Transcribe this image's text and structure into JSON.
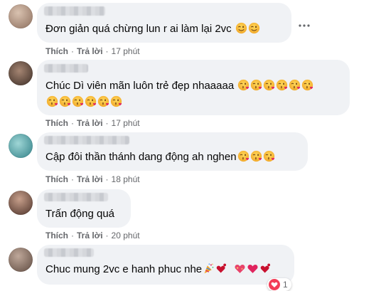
{
  "comments": [
    {
      "text": "Đơn giản quá chừng lun r ai làm lại 2vc",
      "emojis": [
        "wink",
        "wink"
      ],
      "actions": {
        "like": "Thích",
        "reply": "Trả lời",
        "time": "17 phút"
      },
      "avatar_color": "#b9a08f"
    },
    {
      "line1": "Chúc Dì viên mãn luôn trẻ đẹp nhaaaaa",
      "emojis_line1": [
        "kiss",
        "kiss",
        "kiss",
        "kiss",
        "kiss",
        "kiss"
      ],
      "emojis_line2": [
        "kiss",
        "kiss",
        "kiss",
        "kiss",
        "kiss",
        "kiss"
      ],
      "actions": {
        "like": "Thích",
        "reply": "Trả lời",
        "time": "17 phút"
      },
      "avatar_color": "#6a5648"
    },
    {
      "text": "Cập đôi thần thánh dang động ah nghen",
      "emojis": [
        "kiss",
        "kiss",
        "kiss"
      ],
      "actions": {
        "like": "Thích",
        "reply": "Trả lời",
        "time": "18 phút"
      },
      "avatar_color": "#5fb3b8"
    },
    {
      "text": "Trấn động quá",
      "actions": {
        "like": "Thích",
        "reply": "Trả lời",
        "time": "20 phút"
      },
      "avatar_color": "#7a5a4a"
    },
    {
      "text": "Chuc mung 2vc e hanh phuc nhe",
      "emojis": [
        "party",
        "heart-exclaim",
        "heart-sparkle",
        "heart",
        "heart-exclaim"
      ],
      "reaction_count": "1",
      "avatar_color": "#8d7a70"
    }
  ],
  "icons": {
    "more": "more-horizontal-icon",
    "wink": "winking-face-icon",
    "kiss": "face-blowing-kiss-icon",
    "heart": "red-heart-icon",
    "love_reaction": "love-reaction-icon"
  },
  "colors": {
    "bubble": "#f0f2f5",
    "meta_text": "#65676b",
    "emoji_yellow": "#f7c23b",
    "heart_red": "#e0245e"
  }
}
